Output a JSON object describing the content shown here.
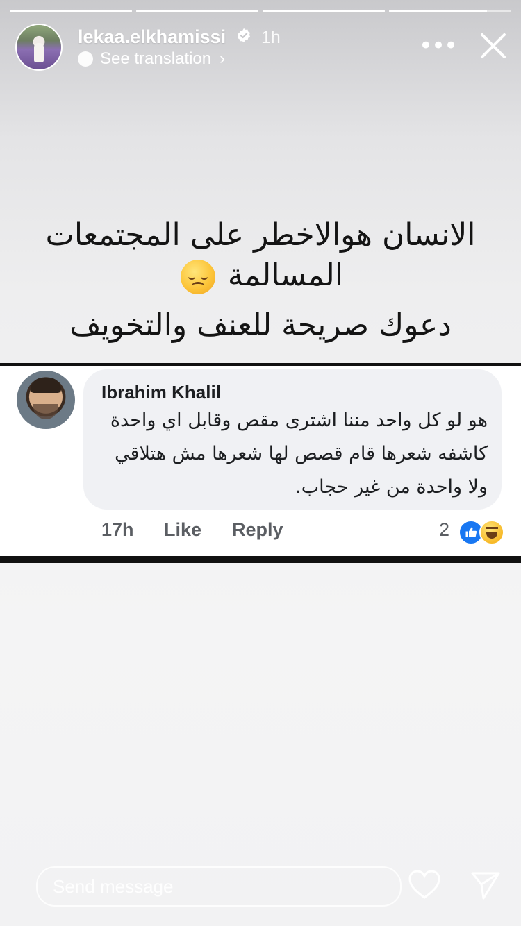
{
  "story": {
    "progress_segments": 4,
    "username": "lekaa.elkhamissi",
    "verified": true,
    "time": "1h",
    "see_translation": "See translation",
    "more_icon": "more-icon",
    "close_icon": "close-icon"
  },
  "caption": {
    "line1": "الانسان هوالاخطر على المجتمعات",
    "line2": "المسالمة",
    "line3": "دعوك صريحة للعنف والتخويف",
    "emoji": "disappointed-face-emoji"
  },
  "comment": {
    "author": "Ibrahim Khalil",
    "text": "هو لو كل واحد مننا اشترى مقص وقابل اي واحدة كاشفه شعرها قام قصص لها شعرها مش هتلاقي ولا واحدة من غير حجاب.",
    "time": "17h",
    "like_label": "Like",
    "reply_label": "Reply",
    "reaction_count": "2",
    "reactions": [
      "like",
      "haha"
    ]
  },
  "footer": {
    "send_placeholder": "Send message",
    "heart_icon": "heart-icon",
    "share_icon": "paper-plane-icon"
  },
  "colors": {
    "like_blue": "#1877f2",
    "comment_bubble": "#f0f1f4"
  }
}
